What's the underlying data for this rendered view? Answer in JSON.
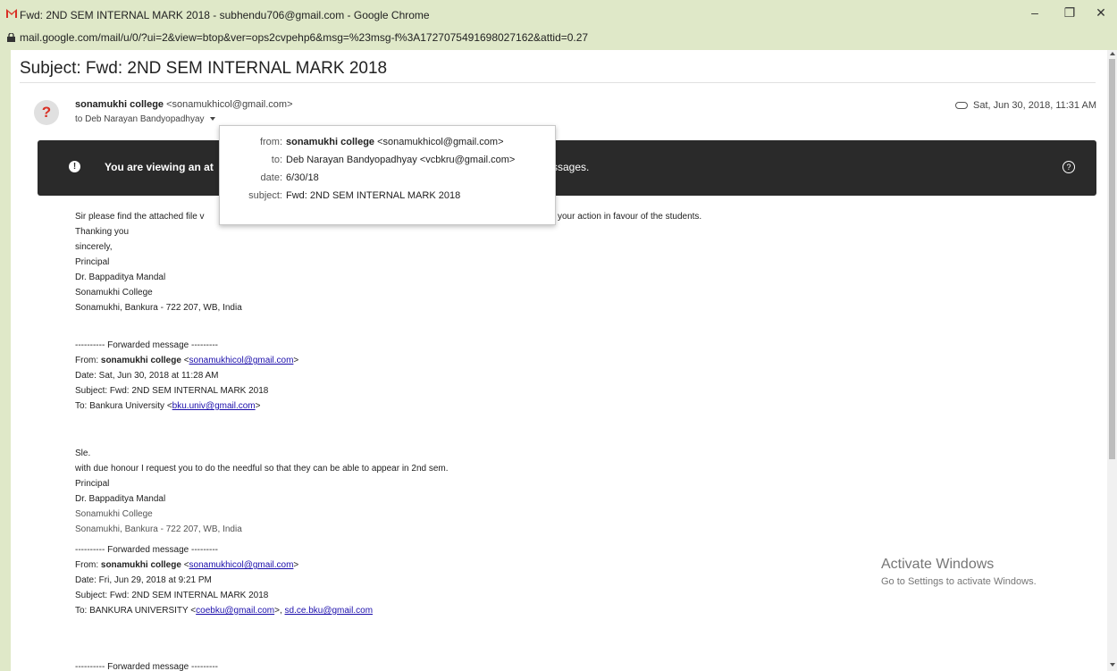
{
  "window": {
    "title": "Fwd: 2ND SEM INTERNAL MARK 2018 - subhendu706@gmail.com - Google Chrome",
    "minimize": "–",
    "maximize": "❐",
    "close": "✕"
  },
  "address_bar": {
    "url": "mail.google.com/mail/u/0/?ui=2&view=btop&ver=ops2cvpehp6&msg=%23msg-f%3A1727075491698027162&attid=0.27"
  },
  "email": {
    "subject": "Subject: Fwd: 2ND SEM INTERNAL MARK 2018",
    "avatar_glyph": "?",
    "sender_name": "sonamukhi college",
    "sender_email": "<sonamukhicol@gmail.com>",
    "to_line": "to Deb Narayan Bandyopadhyay",
    "date": "Sat, Jun 30, 2018, 11:31 AM"
  },
  "banner": {
    "text_left": "You are viewing an at",
    "text_right": "ssages.",
    "help_glyph": "?"
  },
  "popup": {
    "from_label": "from:",
    "from_name": "sonamukhi college",
    "from_email": "<sonamukhicol@gmail.com>",
    "to_label": "to:",
    "to_value": "Deb Narayan Bandyopadhyay <vcbkru@gmail.com>",
    "date_label": "date:",
    "date_value": "6/30/18",
    "subject_label": "subject:",
    "subject_value": "Fwd: 2ND SEM INTERNAL MARK 2018"
  },
  "body": {
    "line1_start": "Sir please find the attached file v",
    "line1_end": "your action in favour of the students.",
    "sig1": [
      "Thanking you",
      "sincerely,",
      "Principal",
      "Dr. Bappaditya Mandal",
      "Sonamukhi College",
      "Sonamukhi, Bankura - 722 207, WB, India"
    ],
    "fwd1": {
      "header": "---------- Forwarded message ---------",
      "from_label": "From: ",
      "from_name": "sonamukhi college",
      "from_email": "sonamukhicol@gmail.com",
      "date": "Date: Sat, Jun 30, 2018 at 11:28 AM",
      "subject": "Subject: Fwd: 2ND SEM INTERNAL MARK 2018",
      "to_prefix": "To: Bankura University <",
      "to_email": "bku.univ@gmail.com",
      "to_suffix": ">"
    },
    "msg2": {
      "greeting": "Sle.",
      "line": "with due honour I request you to do the needful so that they can be able to appear in 2nd sem.",
      "principal": "Principal",
      "name": "Dr. Bappaditya Mandal",
      "college": "Sonamukhi College",
      "address": "Sonamukhi, Bankura - 722 207, WB, India"
    },
    "fwd2": {
      "header": "---------- Forwarded message ---------",
      "from_label": "From: ",
      "from_name": "sonamukhi college",
      "from_email": "sonamukhicol@gmail.com",
      "date": "Date: Fri, Jun 29, 2018 at 9:21 PM",
      "subject": "Subject: Fwd: 2ND SEM INTERNAL MARK 2018",
      "to_prefix": "To: BANKURA UNIVERSITY <",
      "to_email1": "coebku@gmail.com",
      "to_mid": ">, ",
      "to_email2": "sd.ce.bku@gmail.com"
    },
    "fwd3_header": "---------- Forwarded message ---------"
  },
  "watermark": {
    "line1": "Activate Windows",
    "line2": "Go to Settings to activate Windows."
  },
  "colors": {
    "chrome_bg": "#dfe8c8",
    "banner_bg": "#2a2a2a",
    "link": "#1a0dab",
    "gmail_red": "#d93025"
  }
}
